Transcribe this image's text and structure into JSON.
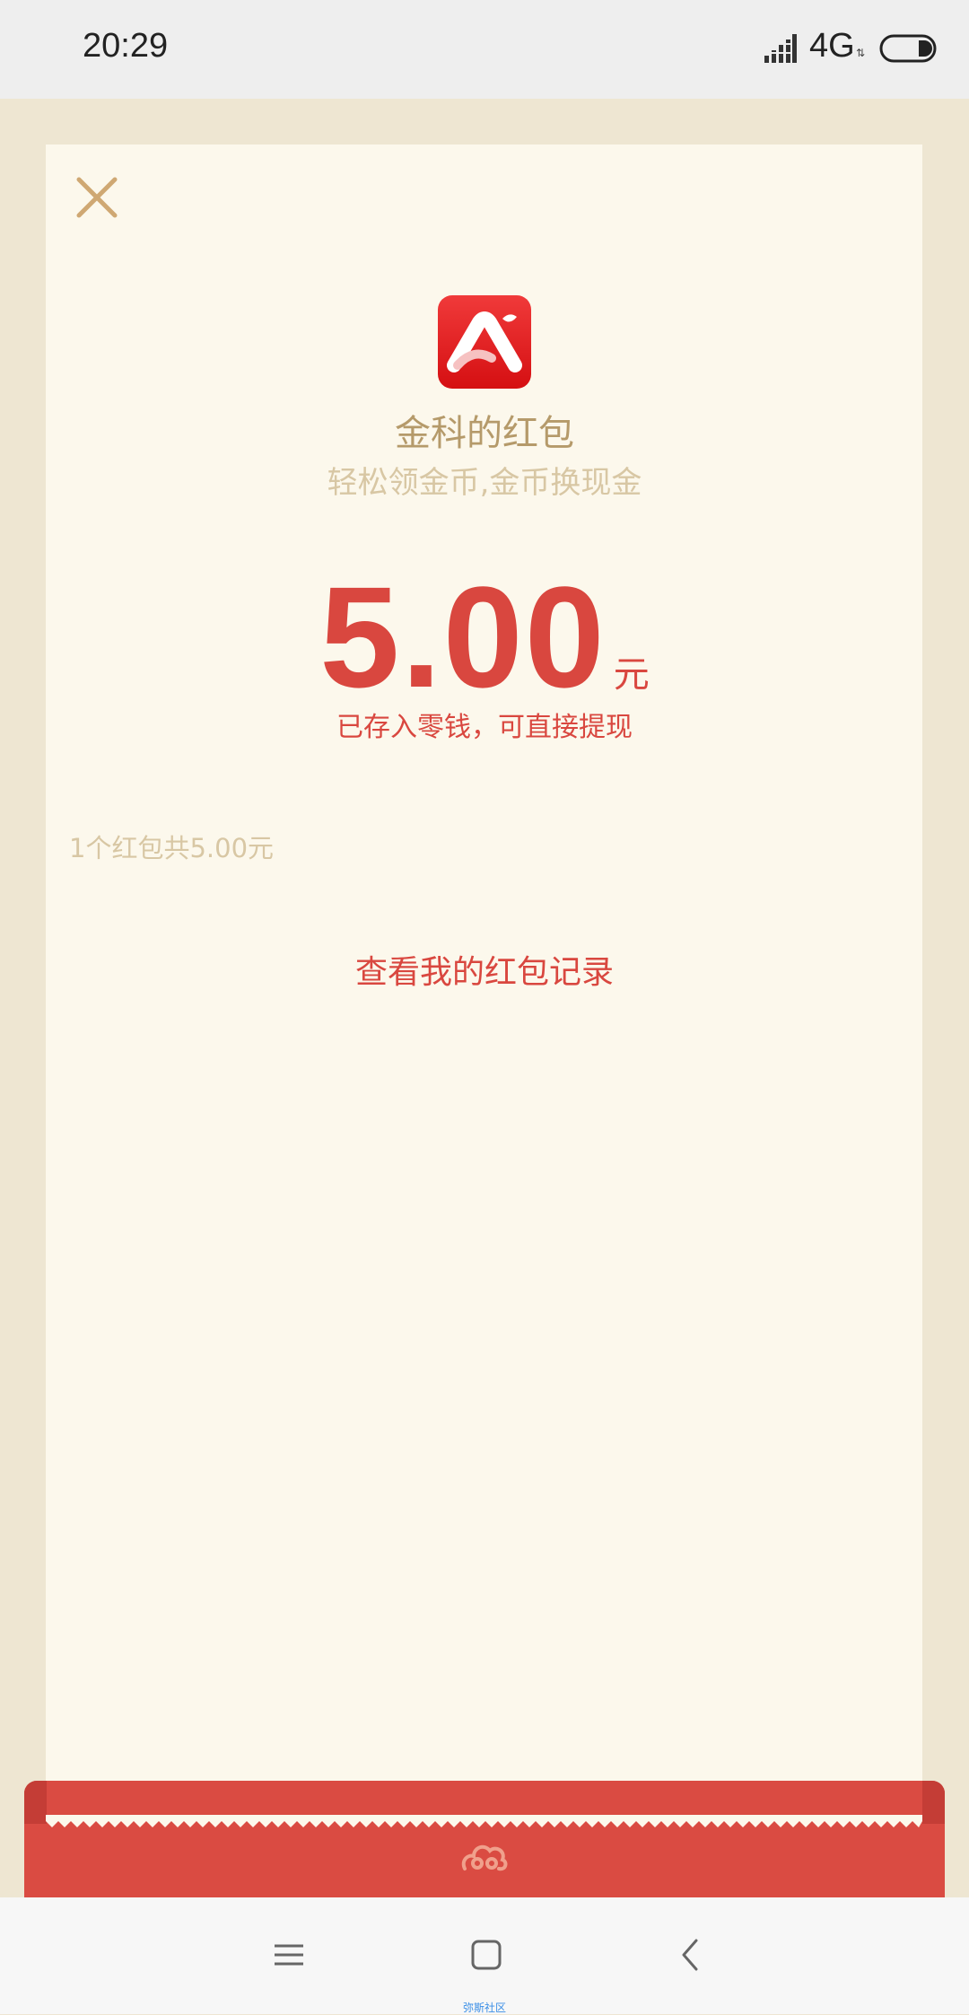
{
  "status_bar": {
    "time": "20:29",
    "network": "4G",
    "signal_icon": "signal-bars-icon",
    "battery_icon": "battery-icon"
  },
  "envelope": {
    "close_icon": "close-icon",
    "app_logo_icon": "app-logo-icon",
    "sender_title": "金科的红包",
    "sender_subtitle": "轻松领金币,金币换现金",
    "amount": "5.00",
    "amount_unit": "元",
    "amount_note": "已存入零钱，可直接提现",
    "summary": "1个红包共5.00元",
    "record_link": "查看我的红包记录",
    "cloud_icon": "auspicious-cloud-icon"
  },
  "nav_bar": {
    "menu_icon": "menu-icon",
    "home_icon": "home-icon",
    "back_icon": "back-icon",
    "watermark": "弥斯社区"
  },
  "colors": {
    "accent_red": "#D9473F",
    "envelope_red": "#DA4B42",
    "gold_text": "#B59A6A",
    "light_gold_text": "#D8C7A4",
    "paper": "#FCF8EC",
    "page_bg": "#EEE6D2"
  }
}
